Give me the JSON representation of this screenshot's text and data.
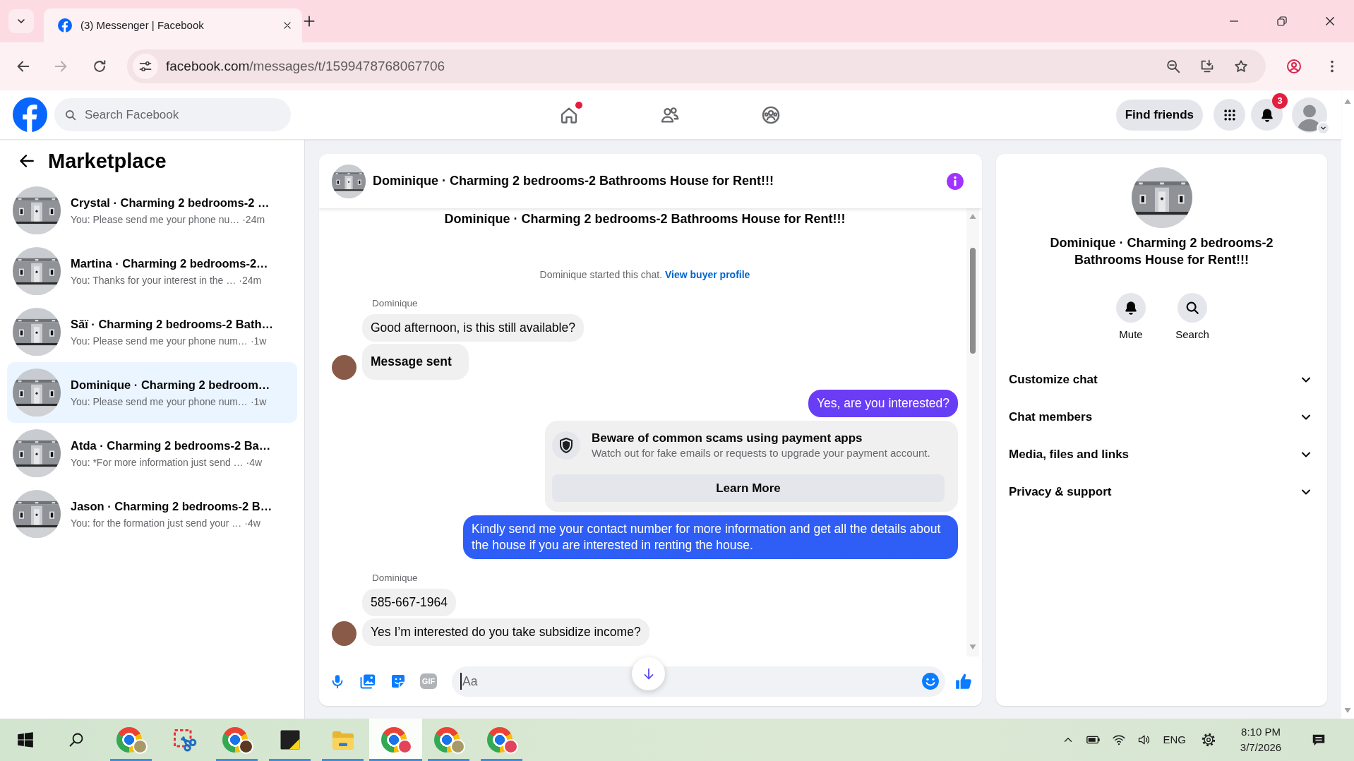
{
  "browser": {
    "tab_title": "(3) Messenger | Facebook",
    "url_host": "facebook.com",
    "url_path": "/messages/t/1599478768067706",
    "nav_buttons": [
      {
        "kind": "back",
        "disabled": false
      },
      {
        "kind": "forward",
        "disabled": true
      },
      {
        "kind": "reload",
        "disabled": false
      }
    ]
  },
  "header": {
    "search_placeholder": "Search Facebook",
    "nav": [
      {
        "kind": "home",
        "dot": true
      },
      {
        "kind": "friends",
        "dot": false
      },
      {
        "kind": "groups",
        "dot": false
      }
    ],
    "find_friends": "Find friends",
    "notification_count": "3"
  },
  "sidebar": {
    "title": "Marketplace",
    "conversations": [
      {
        "title": "Crystal · Charming 2 bedrooms-2 …",
        "preview": "You: Please send me your phone nu…",
        "time": "·24m",
        "selected": false
      },
      {
        "title": "Martina · Charming 2 bedrooms-2…",
        "preview": "You: Thanks for your interest in the …",
        "time": "·24m",
        "selected": false
      },
      {
        "title": "Săï · Charming 2 bedrooms-2 Bath…",
        "preview": "You: Please send me your phone num…",
        "time": "·1w",
        "selected": false
      },
      {
        "title": "Dominique · Charming 2 bedroom…",
        "preview": "You: Please send me your phone num…",
        "time": "·1w",
        "selected": true
      },
      {
        "title": "Atda · Charming 2 bedrooms-2 Ba…",
        "preview": "You: *For more information just send …",
        "time": "·4w",
        "selected": false
      },
      {
        "title": "Jason · Charming 2 bedrooms-2 B…",
        "preview": "You: for the formation just send your …",
        "time": "·4w",
        "selected": false
      }
    ]
  },
  "chat": {
    "title": "Dominique · Charming 2 bedrooms-2 Bathrooms House for Rent!!!",
    "thread_title": "Dominique · Charming 2 bedrooms-2 Bathrooms House for Rent!!!",
    "messages": [
      {
        "kind": "notice",
        "text": "Dominique started this chat.",
        "link": "View buyer profile"
      },
      {
        "kind": "incoming",
        "sender": "Dominique",
        "bubbles": [
          {
            "kind": "text",
            "text": "Good afternoon, is this still available?"
          },
          {
            "kind": "status",
            "text": "Message sent"
          }
        ]
      },
      {
        "kind": "outgoing",
        "text": "Yes, are you interested?"
      },
      {
        "kind": "alert",
        "title": "Beware of common scams using payment apps",
        "text": "Watch out for fake emails or requests to upgrade your payment account.",
        "button": "Learn More"
      },
      {
        "kind": "outgoing",
        "text": "Kindly send me your contact number for more information and get all the details about the house if you are interested in renting the house."
      },
      {
        "kind": "incoming",
        "sender": "Dominique",
        "bubbles": [
          {
            "kind": "text",
            "text": "585-667-1964"
          },
          {
            "kind": "text",
            "text": "Yes I’m interested do you take subsidize income?"
          }
        ]
      }
    ],
    "composer": {
      "gif_label": "GIF",
      "placeholder": "Aa"
    }
  },
  "details": {
    "title": "Dominique · Charming 2 bedrooms-2 Bathrooms House for Rent!!!",
    "actions": [
      {
        "kind": "mute",
        "label": "Mute"
      },
      {
        "kind": "search",
        "label": "Search"
      }
    ],
    "sections": [
      {
        "label": "Customize chat",
        "expanded": false
      },
      {
        "label": "Chat members",
        "expanded": false
      },
      {
        "label": "Media, files and links",
        "expanded": false
      },
      {
        "label": "Privacy & support",
        "expanded": false
      }
    ]
  },
  "taskbar": {
    "apps": [
      {
        "kind": "browser",
        "color": "#a89a68",
        "running": true,
        "selected": false
      },
      {
        "kind": "snip",
        "running": false,
        "selected": false
      },
      {
        "kind": "browser",
        "color": "#5a3a22",
        "running": true,
        "selected": false
      },
      {
        "kind": "sticky",
        "running": true,
        "selected": false
      },
      {
        "kind": "folder",
        "running": true,
        "selected": false
      },
      {
        "kind": "browser",
        "color": "#e2445c",
        "running": true,
        "selected": true
      },
      {
        "kind": "browser",
        "color": "#a89a68",
        "running": true,
        "selected": false
      },
      {
        "kind": "browser",
        "color": "#e2445c",
        "running": true,
        "selected": false
      }
    ],
    "tray": {
      "language": "ENG",
      "time": "8:10 PM",
      "date": "3/7/2026"
    }
  }
}
